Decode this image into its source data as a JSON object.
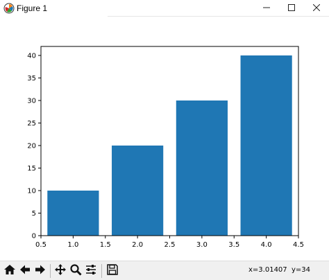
{
  "window": {
    "title": "Figure 1",
    "minimize_icon": "minimize-icon",
    "maximize_icon": "maximize-icon",
    "close_icon": "close-icon"
  },
  "chart_data": {
    "type": "bar",
    "x": [
      1.0,
      2.0,
      3.0,
      4.0
    ],
    "values": [
      10,
      20,
      30,
      40
    ],
    "bar_color": "#1f77b4",
    "xlim": [
      0.5,
      4.5
    ],
    "ylim": [
      0,
      42
    ],
    "xticks": [
      "0.5",
      "1.0",
      "1.5",
      "2.0",
      "2.5",
      "3.0",
      "3.5",
      "4.0",
      "4.5"
    ],
    "xtick_values": [
      0.5,
      1.0,
      1.5,
      2.0,
      2.5,
      3.0,
      3.5,
      4.0,
      4.5
    ],
    "yticks": [
      "0",
      "5",
      "10",
      "15",
      "20",
      "25",
      "30",
      "35",
      "40"
    ],
    "ytick_values": [
      0,
      5,
      10,
      15,
      20,
      25,
      30,
      35,
      40
    ],
    "grid": false,
    "title": "",
    "xlabel": "",
    "ylabel": ""
  },
  "toolbar": {
    "buttons": [
      "home-icon",
      "back-icon",
      "forward-icon",
      "pan-icon",
      "zoom-icon",
      "configure-subplots-icon",
      "save-icon"
    ],
    "coord_x": "x=3.01407",
    "coord_y": "y=34"
  }
}
